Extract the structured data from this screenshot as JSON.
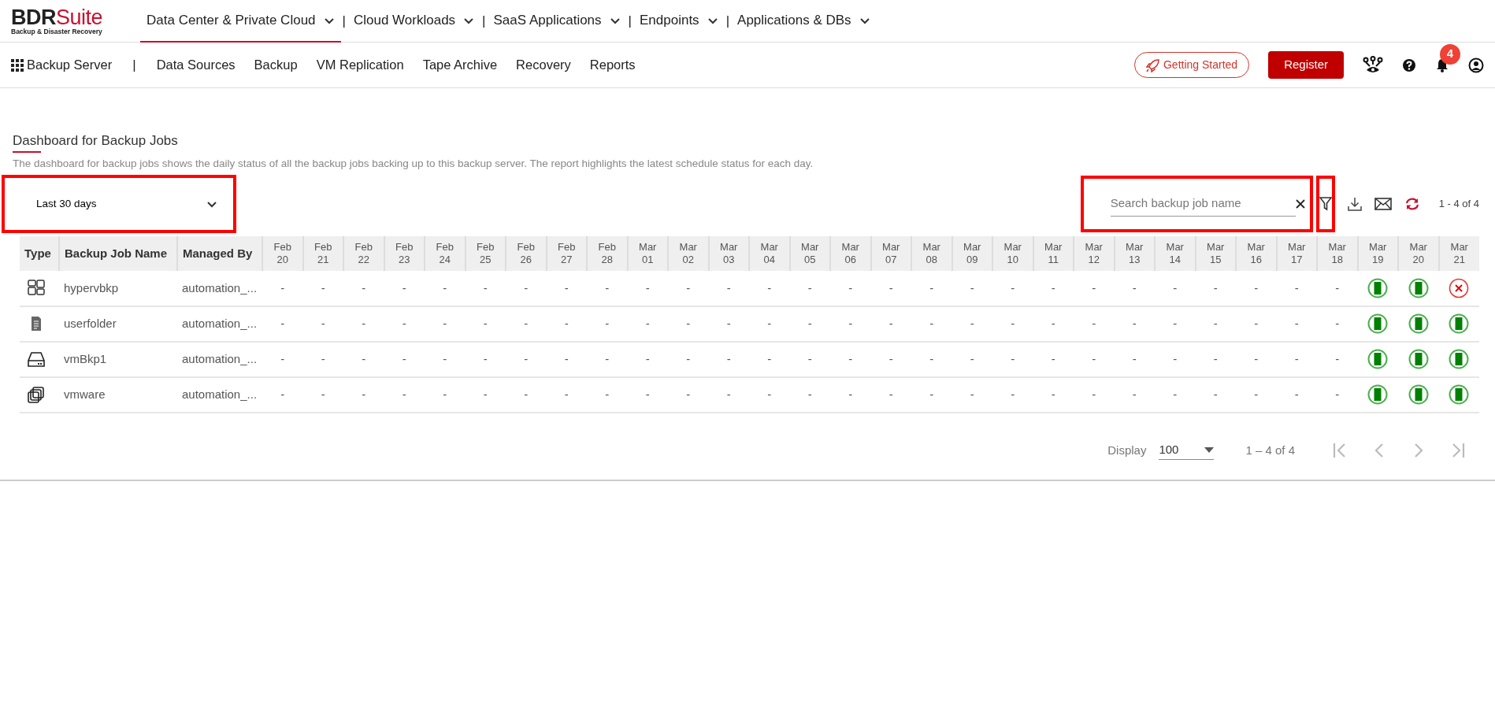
{
  "brand": {
    "name": [
      {
        "text": "BDR",
        "accent": false
      },
      {
        "text": "Suite",
        "accent": true
      }
    ],
    "tagline": "Backup & Disaster Recovery"
  },
  "top_nav": [
    {
      "label": "Data Center & Private Cloud",
      "selected": true
    },
    {
      "label": "Cloud Workloads",
      "selected": false
    },
    {
      "label": "SaaS Applications",
      "selected": false
    },
    {
      "label": "Endpoints",
      "selected": false
    },
    {
      "label": "Applications & DBs",
      "selected": false
    }
  ],
  "separator": "|",
  "sub_nav": {
    "title": "Backup Server",
    "items": [
      "Data Sources",
      "Backup",
      "VM Replication",
      "Tape Archive",
      "Recovery",
      "Reports"
    ]
  },
  "actions": {
    "getting_started": "Getting Started",
    "register": "Register",
    "notifications": "4"
  },
  "page": {
    "title": "Dashboard for Backup Jobs",
    "description": "The dashboard for backup jobs shows the daily status of all the backup jobs backing up to this backup server. The report highlights the latest schedule status for each day."
  },
  "range": {
    "value": "Last 30 days",
    "highlighted": true
  },
  "search": {
    "placeholder": "Search backup job name",
    "highlighted": true
  },
  "filter": {
    "highlighted": true
  },
  "record_count": "1 - 4 of 4",
  "table": {
    "columns": [
      "Type",
      "Backup Job Name",
      "Managed By"
    ],
    "dates": [
      {
        "month": "Feb",
        "day": "20"
      },
      {
        "month": "Feb",
        "day": "21"
      },
      {
        "month": "Feb",
        "day": "22"
      },
      {
        "month": "Feb",
        "day": "23"
      },
      {
        "month": "Feb",
        "day": "24"
      },
      {
        "month": "Feb",
        "day": "25"
      },
      {
        "month": "Feb",
        "day": "26"
      },
      {
        "month": "Feb",
        "day": "27"
      },
      {
        "month": "Feb",
        "day": "28"
      },
      {
        "month": "Mar",
        "day": "01"
      },
      {
        "month": "Mar",
        "day": "02"
      },
      {
        "month": "Mar",
        "day": "03"
      },
      {
        "month": "Mar",
        "day": "04"
      },
      {
        "month": "Mar",
        "day": "05"
      },
      {
        "month": "Mar",
        "day": "06"
      },
      {
        "month": "Mar",
        "day": "07"
      },
      {
        "month": "Mar",
        "day": "08"
      },
      {
        "month": "Mar",
        "day": "09"
      },
      {
        "month": "Mar",
        "day": "10"
      },
      {
        "month": "Mar",
        "day": "11"
      },
      {
        "month": "Mar",
        "day": "12"
      },
      {
        "month": "Mar",
        "day": "13"
      },
      {
        "month": "Mar",
        "day": "14"
      },
      {
        "month": "Mar",
        "day": "15"
      },
      {
        "month": "Mar",
        "day": "16"
      },
      {
        "month": "Mar",
        "day": "17"
      },
      {
        "month": "Mar",
        "day": "18"
      },
      {
        "month": "Mar",
        "day": "19"
      },
      {
        "month": "Mar",
        "day": "20"
      },
      {
        "month": "Mar",
        "day": "21"
      }
    ],
    "rows": [
      {
        "kind": "hyperv",
        "name": "hypervbkp",
        "managed_by": "automation_...",
        "cells": [
          {
            "kind": "none",
            "text": "-"
          },
          {
            "kind": "none",
            "text": "-"
          },
          {
            "kind": "none",
            "text": "-"
          },
          {
            "kind": "none",
            "text": "-"
          },
          {
            "kind": "none",
            "text": "-"
          },
          {
            "kind": "none",
            "text": "-"
          },
          {
            "kind": "none",
            "text": "-"
          },
          {
            "kind": "none",
            "text": "-"
          },
          {
            "kind": "none",
            "text": "-"
          },
          {
            "kind": "none",
            "text": "-"
          },
          {
            "kind": "none",
            "text": "-"
          },
          {
            "kind": "none",
            "text": "-"
          },
          {
            "kind": "none",
            "text": "-"
          },
          {
            "kind": "none",
            "text": "-"
          },
          {
            "kind": "none",
            "text": "-"
          },
          {
            "kind": "none",
            "text": "-"
          },
          {
            "kind": "none",
            "text": "-"
          },
          {
            "kind": "none",
            "text": "-"
          },
          {
            "kind": "none",
            "text": "-"
          },
          {
            "kind": "none",
            "text": "-"
          },
          {
            "kind": "none",
            "text": "-"
          },
          {
            "kind": "none",
            "text": "-"
          },
          {
            "kind": "none",
            "text": "-"
          },
          {
            "kind": "none",
            "text": "-"
          },
          {
            "kind": "none",
            "text": "-"
          },
          {
            "kind": "none",
            "text": "-"
          },
          {
            "kind": "none",
            "text": "-"
          },
          {
            "kind": "success"
          },
          {
            "kind": "success"
          },
          {
            "kind": "failed"
          }
        ]
      },
      {
        "kind": "file",
        "name": "userfolder",
        "managed_by": "automation_...",
        "cells": [
          {
            "kind": "none",
            "text": "-"
          },
          {
            "kind": "none",
            "text": "-"
          },
          {
            "kind": "none",
            "text": "-"
          },
          {
            "kind": "none",
            "text": "-"
          },
          {
            "kind": "none",
            "text": "-"
          },
          {
            "kind": "none",
            "text": "-"
          },
          {
            "kind": "none",
            "text": "-"
          },
          {
            "kind": "none",
            "text": "-"
          },
          {
            "kind": "none",
            "text": "-"
          },
          {
            "kind": "none",
            "text": "-"
          },
          {
            "kind": "none",
            "text": "-"
          },
          {
            "kind": "none",
            "text": "-"
          },
          {
            "kind": "none",
            "text": "-"
          },
          {
            "kind": "none",
            "text": "-"
          },
          {
            "kind": "none",
            "text": "-"
          },
          {
            "kind": "none",
            "text": "-"
          },
          {
            "kind": "none",
            "text": "-"
          },
          {
            "kind": "none",
            "text": "-"
          },
          {
            "kind": "none",
            "text": "-"
          },
          {
            "kind": "none",
            "text": "-"
          },
          {
            "kind": "none",
            "text": "-"
          },
          {
            "kind": "none",
            "text": "-"
          },
          {
            "kind": "none",
            "text": "-"
          },
          {
            "kind": "none",
            "text": "-"
          },
          {
            "kind": "none",
            "text": "-"
          },
          {
            "kind": "none",
            "text": "-"
          },
          {
            "kind": "none",
            "text": "-"
          },
          {
            "kind": "success"
          },
          {
            "kind": "success"
          },
          {
            "kind": "success"
          }
        ]
      },
      {
        "kind": "disk",
        "name": "vmBkp1",
        "managed_by": "automation_...",
        "cells": [
          {
            "kind": "none",
            "text": "-"
          },
          {
            "kind": "none",
            "text": "-"
          },
          {
            "kind": "none",
            "text": "-"
          },
          {
            "kind": "none",
            "text": "-"
          },
          {
            "kind": "none",
            "text": "-"
          },
          {
            "kind": "none",
            "text": "-"
          },
          {
            "kind": "none",
            "text": "-"
          },
          {
            "kind": "none",
            "text": "-"
          },
          {
            "kind": "none",
            "text": "-"
          },
          {
            "kind": "none",
            "text": "-"
          },
          {
            "kind": "none",
            "text": "-"
          },
          {
            "kind": "none",
            "text": "-"
          },
          {
            "kind": "none",
            "text": "-"
          },
          {
            "kind": "none",
            "text": "-"
          },
          {
            "kind": "none",
            "text": "-"
          },
          {
            "kind": "none",
            "text": "-"
          },
          {
            "kind": "none",
            "text": "-"
          },
          {
            "kind": "none",
            "text": "-"
          },
          {
            "kind": "none",
            "text": "-"
          },
          {
            "kind": "none",
            "text": "-"
          },
          {
            "kind": "none",
            "text": "-"
          },
          {
            "kind": "none",
            "text": "-"
          },
          {
            "kind": "none",
            "text": "-"
          },
          {
            "kind": "none",
            "text": "-"
          },
          {
            "kind": "none",
            "text": "-"
          },
          {
            "kind": "none",
            "text": "-"
          },
          {
            "kind": "none",
            "text": "-"
          },
          {
            "kind": "success"
          },
          {
            "kind": "success"
          },
          {
            "kind": "success"
          }
        ]
      },
      {
        "kind": "vmware",
        "name": "vmware",
        "managed_by": "automation_...",
        "cells": [
          {
            "kind": "none",
            "text": "-"
          },
          {
            "kind": "none",
            "text": "-"
          },
          {
            "kind": "none",
            "text": "-"
          },
          {
            "kind": "none",
            "text": "-"
          },
          {
            "kind": "none",
            "text": "-"
          },
          {
            "kind": "none",
            "text": "-"
          },
          {
            "kind": "none",
            "text": "-"
          },
          {
            "kind": "none",
            "text": "-"
          },
          {
            "kind": "none",
            "text": "-"
          },
          {
            "kind": "none",
            "text": "-"
          },
          {
            "kind": "none",
            "text": "-"
          },
          {
            "kind": "none",
            "text": "-"
          },
          {
            "kind": "none",
            "text": "-"
          },
          {
            "kind": "none",
            "text": "-"
          },
          {
            "kind": "none",
            "text": "-"
          },
          {
            "kind": "none",
            "text": "-"
          },
          {
            "kind": "none",
            "text": "-"
          },
          {
            "kind": "none",
            "text": "-"
          },
          {
            "kind": "none",
            "text": "-"
          },
          {
            "kind": "none",
            "text": "-"
          },
          {
            "kind": "none",
            "text": "-"
          },
          {
            "kind": "none",
            "text": "-"
          },
          {
            "kind": "none",
            "text": "-"
          },
          {
            "kind": "none",
            "text": "-"
          },
          {
            "kind": "none",
            "text": "-"
          },
          {
            "kind": "none",
            "text": "-"
          },
          {
            "kind": "none",
            "text": "-"
          },
          {
            "kind": "success"
          },
          {
            "kind": "success"
          },
          {
            "kind": "success"
          }
        ]
      }
    ]
  },
  "pagination": {
    "label": "Display",
    "page_size": "100",
    "range": "1 – 4 of 4",
    "buttons": [
      {
        "kind": "first",
        "disabled": true
      },
      {
        "kind": "prev",
        "disabled": true
      },
      {
        "kind": "next",
        "disabled": true
      },
      {
        "kind": "last",
        "disabled": true
      }
    ]
  }
}
